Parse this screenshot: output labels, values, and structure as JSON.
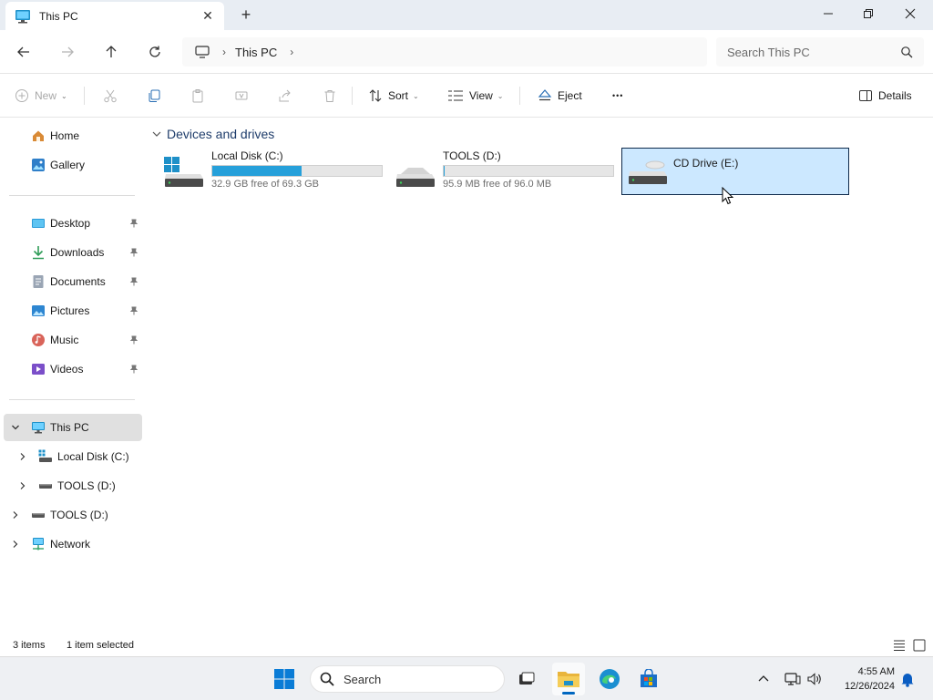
{
  "window": {
    "tab_title": "This PC",
    "new_tab": "+"
  },
  "address": {
    "crumbs": [
      "This PC"
    ],
    "search_placeholder": "Search This PC"
  },
  "commands": {
    "new": "New",
    "sort": "Sort",
    "view": "View",
    "eject": "Eject",
    "more": "•••",
    "details": "Details"
  },
  "sidebar": {
    "quick": [
      {
        "label": "Home",
        "icon": "home-icon"
      },
      {
        "label": "Gallery",
        "icon": "gallery-icon"
      }
    ],
    "pinned": [
      {
        "label": "Desktop",
        "icon": "desktop-icon"
      },
      {
        "label": "Downloads",
        "icon": "downloads-icon"
      },
      {
        "label": "Documents",
        "icon": "documents-icon"
      },
      {
        "label": "Pictures",
        "icon": "pictures-icon"
      },
      {
        "label": "Music",
        "icon": "music-icon"
      },
      {
        "label": "Videos",
        "icon": "videos-icon"
      }
    ],
    "tree": [
      {
        "label": "This PC",
        "icon": "this-pc-icon",
        "expanded": true,
        "selected": true
      },
      {
        "label": "Local Disk (C:)",
        "icon": "drive-c-icon",
        "level": 1
      },
      {
        "label": "TOOLS (D:)",
        "icon": "drive-d-icon",
        "level": 1
      },
      {
        "label": "TOOLS (D:)",
        "icon": "drive-d-icon",
        "level": 0
      },
      {
        "label": "Network",
        "icon": "network-icon",
        "level": 0
      }
    ]
  },
  "content": {
    "group_title": "Devices and drives",
    "drives": [
      {
        "name": "Local Disk (C:)",
        "free_text": "32.9 GB free of 69.3 GB",
        "used_fraction": 0.525,
        "bar_color": "#26a0da",
        "icon": "windows-drive-icon"
      },
      {
        "name": "TOOLS (D:)",
        "free_text": "95.9 MB free of 96.0 MB",
        "used_fraction": 0.001,
        "bar_color": "#26a0da",
        "icon": "drive-icon"
      },
      {
        "name": "CD Drive (E:)",
        "free_text": "",
        "used_fraction": null,
        "selected": true,
        "icon": "cd-drive-icon"
      }
    ]
  },
  "status": {
    "items": "3 items",
    "selected": "1 item selected"
  },
  "taskbar": {
    "search_label": "Search",
    "time": "4:55 AM",
    "date": "12/26/2024"
  },
  "colors": {
    "accent": "#0067c0",
    "selection_bg": "#cce8ff",
    "usage_bar": "#26a0da"
  }
}
